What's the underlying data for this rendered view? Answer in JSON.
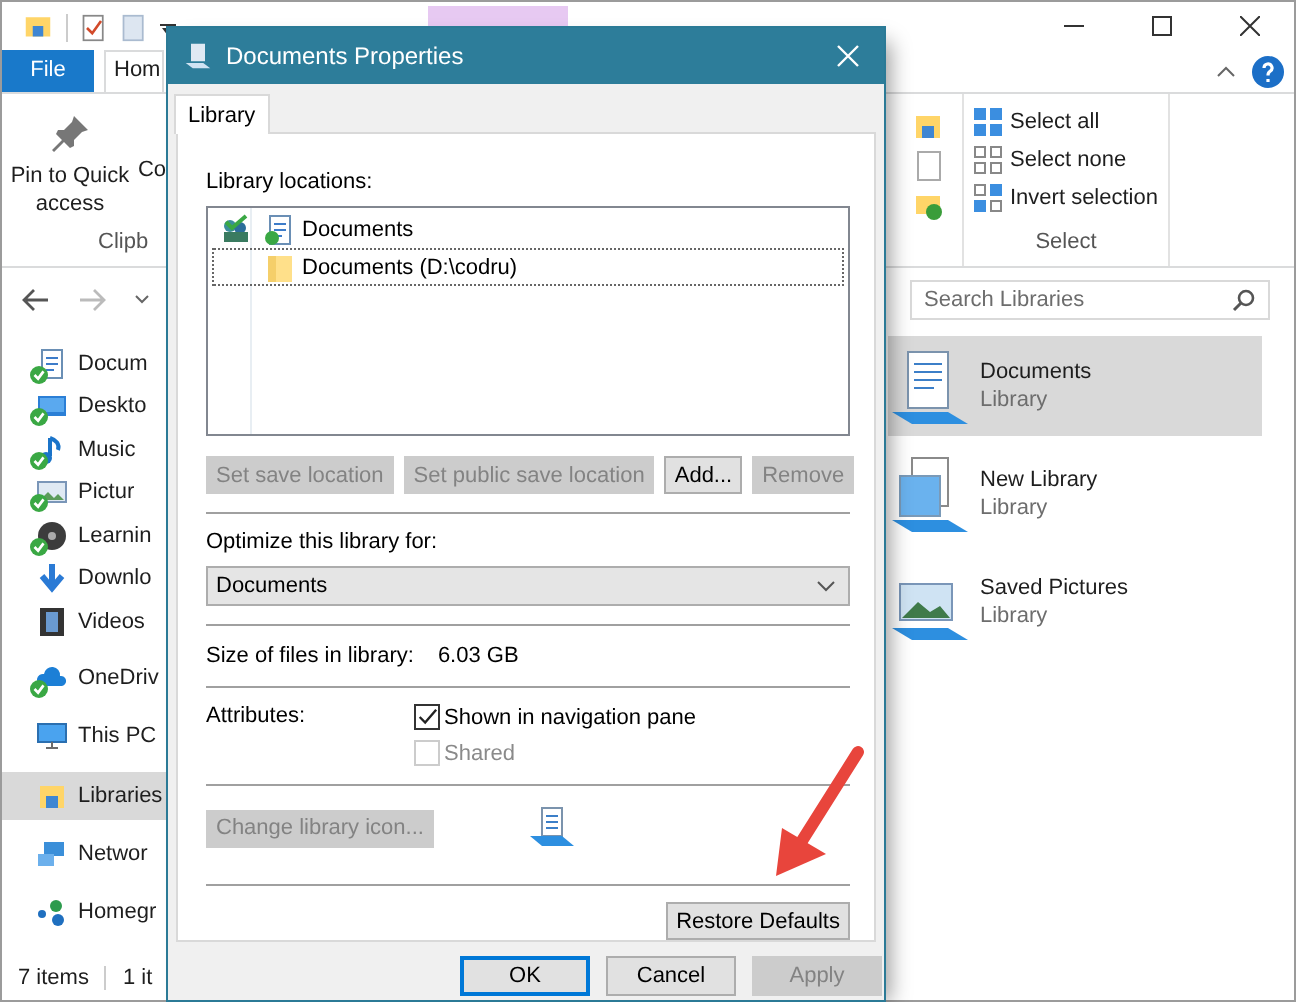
{
  "explorer": {
    "ribbon_tabs": [
      {
        "label": "File",
        "kind": "file",
        "selected": false
      },
      {
        "label": "Hom",
        "kind": "tab",
        "selected": true
      }
    ],
    "ribbon": {
      "clipboard": {
        "pin_button": "Pin to Quick access",
        "copy_button": "Co",
        "group_label": "Clipb"
      },
      "select": {
        "buttons": [
          {
            "label": "Select all",
            "kind": "all"
          },
          {
            "label": "Select none",
            "kind": "none"
          },
          {
            "label": "Invert selection",
            "kind": "invert"
          }
        ],
        "group_label": "Select"
      }
    },
    "search": {
      "placeholder": "Search Libraries"
    },
    "nav": {
      "sections": [
        {
          "items": [
            {
              "label": "Docum",
              "kind": "documents",
              "synced": true,
              "selected": false
            },
            {
              "label": "Deskto",
              "kind": "desktop",
              "synced": true,
              "selected": false
            },
            {
              "label": "Music",
              "kind": "music",
              "synced": true,
              "selected": false
            },
            {
              "label": "Pictur",
              "kind": "pictures",
              "synced": true,
              "selected": false
            },
            {
              "label": "Learnin",
              "kind": "disc",
              "synced": true,
              "selected": false
            },
            {
              "label": "Downlo",
              "kind": "downloads",
              "synced": false,
              "selected": false
            },
            {
              "label": "Videos",
              "kind": "videos",
              "synced": false,
              "selected": false
            }
          ]
        },
        {
          "items": [
            {
              "label": "OneDriv",
              "kind": "cloud",
              "synced": true,
              "selected": false
            }
          ]
        },
        {
          "items": [
            {
              "label": "This PC",
              "kind": "pc",
              "synced": false,
              "selected": false
            }
          ]
        },
        {
          "items": [
            {
              "label": "Libraries",
              "kind": "libraries",
              "synced": false,
              "selected": true
            }
          ]
        },
        {
          "items": [
            {
              "label": "Networ",
              "kind": "network",
              "synced": false,
              "selected": false
            }
          ]
        },
        {
          "items": [
            {
              "label": "Homegr",
              "kind": "homegroup",
              "synced": false,
              "selected": false
            }
          ]
        }
      ]
    },
    "libraries": [
      {
        "name": "Documents",
        "type": "Library",
        "kind": "documents",
        "selected": true
      },
      {
        "name": "New Library",
        "type": "Library",
        "kind": "blank",
        "selected": false
      },
      {
        "name": "Saved Pictures",
        "type": "Library",
        "kind": "pictures",
        "selected": false
      }
    ],
    "status_bar": {
      "item_count": "7 items",
      "selection": "1 it"
    }
  },
  "dialog": {
    "title": "Documents Properties",
    "tabs": [
      {
        "label": "Library",
        "selected": true
      }
    ],
    "locations_label": "Library locations:",
    "locations": [
      {
        "name": "Documents",
        "kind": "library",
        "save_location": true,
        "focused": false
      },
      {
        "name": "Documents (D:\\codru)",
        "kind": "folder",
        "save_location": false,
        "focused": true
      }
    ],
    "location_buttons": [
      {
        "label": "Set save location",
        "disabled": true
      },
      {
        "label": "Set public save location",
        "disabled": true
      },
      {
        "label": "Add...",
        "disabled": false
      },
      {
        "label": "Remove",
        "disabled": true
      }
    ],
    "optimize_label": "Optimize this library for:",
    "optimize_select": {
      "value": "Documents"
    },
    "size_label": "Size of files in library:",
    "size_value": "6.03 GB",
    "attributes_label": "Attributes:",
    "attributes": [
      {
        "label": "Shown in navigation pane",
        "checked": true,
        "disabled": false
      },
      {
        "label": "Shared",
        "checked": false,
        "disabled": true
      }
    ],
    "change_icon_button": {
      "label": "Change library icon...",
      "disabled": true
    },
    "restore_button": {
      "label": "Restore Defaults",
      "disabled": false
    },
    "footer_buttons": [
      {
        "label": "OK",
        "default": true,
        "disabled": false
      },
      {
        "label": "Cancel",
        "default": false,
        "disabled": false
      },
      {
        "label": "Apply",
        "default": false,
        "disabled": true
      }
    ]
  }
}
